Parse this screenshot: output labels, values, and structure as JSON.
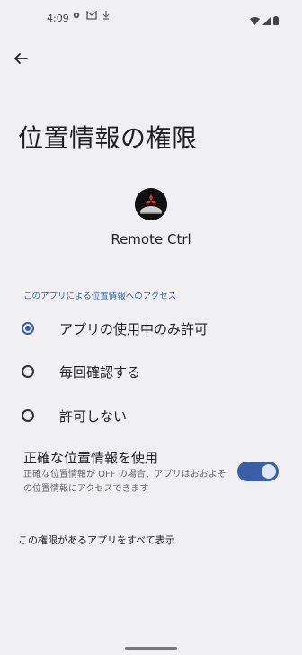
{
  "status_bar": {
    "time": "4:09",
    "left_icons": [
      "gear-icon",
      "app-notification-icon",
      "download-icon"
    ],
    "right_icons": [
      "wifi-icon",
      "signal-icon",
      "battery-icon"
    ]
  },
  "header": {
    "back_icon": "arrow-left-icon",
    "title": "位置情報の権限"
  },
  "app": {
    "name": "Remote Ctrl",
    "icon": "mitsubishi-logo-icon"
  },
  "section_header": "このアプリによる位置情報へのアクセス",
  "options": [
    {
      "label": "アプリの使用中のみ許可",
      "selected": true
    },
    {
      "label": "毎回確認する",
      "selected": false
    },
    {
      "label": "許可しない",
      "selected": false
    }
  ],
  "precise_location": {
    "title": "正確な位置情報を使用",
    "description": "正確な位置情報が OFF の場合、アプリはおおよその位置情報にアクセスできます",
    "enabled": true
  },
  "see_all_link": "この権限があるアプリをすべて表示",
  "colors": {
    "accent": "#3a5fa8",
    "background": "#f0f0f3"
  }
}
